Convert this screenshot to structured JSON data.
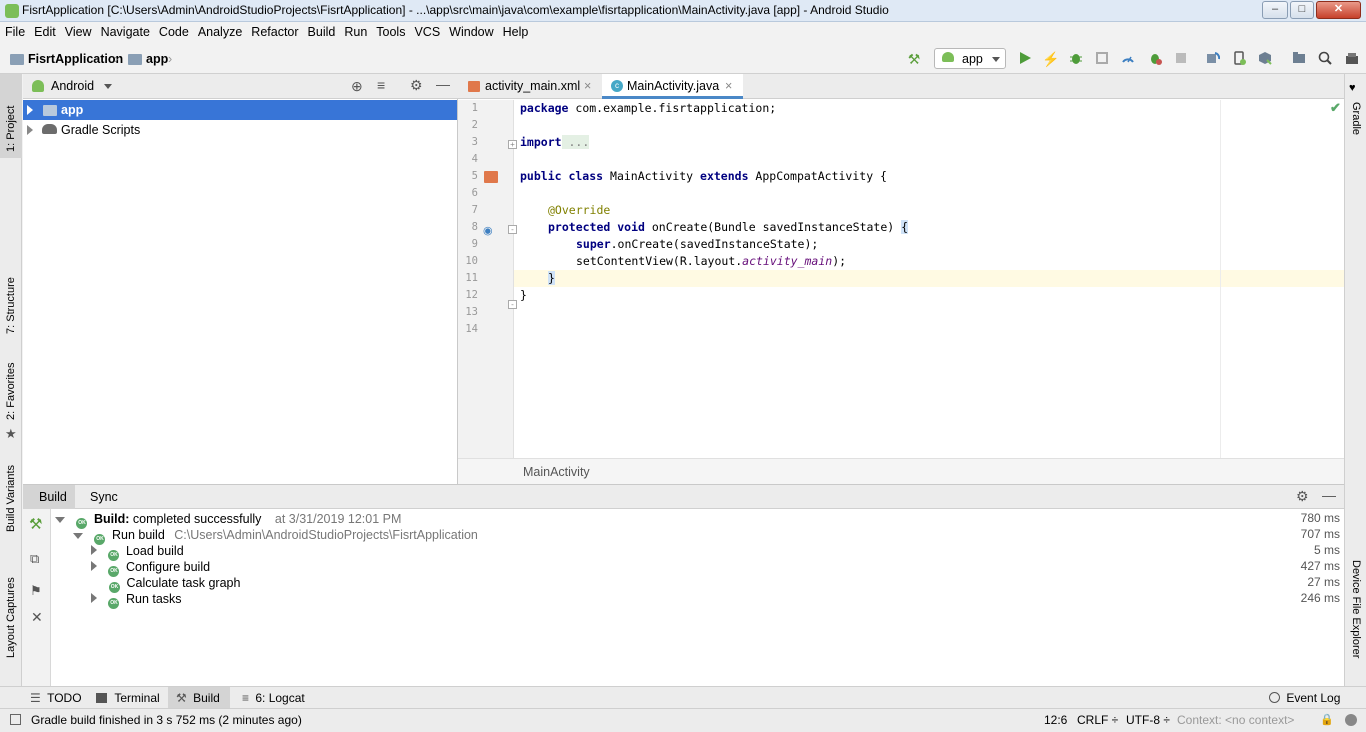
{
  "window": {
    "title": "FisrtApplication [C:\\Users\\Admin\\AndroidStudioProjects\\FisrtApplication] - ...\\app\\src\\main\\java\\com\\example\\fisrtapplication\\MainActivity.java [app] - Android Studio",
    "minimize": "–",
    "maximize": "□",
    "close": "✕"
  },
  "menu": [
    "File",
    "Edit",
    "View",
    "Navigate",
    "Code",
    "Analyze",
    "Refactor",
    "Build",
    "Run",
    "Tools",
    "VCS",
    "Window",
    "Help"
  ],
  "nav": {
    "project": "FisrtApplication",
    "module": "app",
    "run_config": "app",
    "sep": "›"
  },
  "left_tabs": [
    "1: Project",
    "7: Structure",
    "2: Favorites",
    "Build Variants",
    "Layout Captures"
  ],
  "right_tabs": [
    "Gradle",
    "Device File Explorer"
  ],
  "project_panel": {
    "view": "Android",
    "items": [
      {
        "label": "app"
      },
      {
        "label": "Gradle Scripts"
      }
    ]
  },
  "editor": {
    "tabs": [
      {
        "label": "activity_main.xml"
      },
      {
        "label": "MainActivity.java"
      }
    ],
    "tab_close": "×",
    "line_numbers": [
      "1",
      "2",
      "3",
      "4",
      "5",
      "6",
      "7",
      "8",
      "9",
      "10",
      "11",
      "12",
      "13",
      "14"
    ],
    "code": {
      "l1_kw": "package",
      "l1_rest": " com.example.fisrtapplication;",
      "l3_kw": "import",
      "l3_fold": " ...",
      "l6_kw1": "public class",
      "l6_mid": " MainActivity ",
      "l6_kw2": "extends",
      "l6_rest": " AppCompatActivity {",
      "l8_ann": "@Override",
      "l9_kw": "protected void",
      "l9_rest": " onCreate(Bundle savedInstanceState) ",
      "l9_brace": "{",
      "l10_kw": "super",
      "l10_rest": ".onCreate(savedInstanceState);",
      "l11_pre": "setContentView(R.layout.",
      "l11_fld": "activity_main",
      "l11_post": ");",
      "l12": "}",
      "l13": "}"
    },
    "breadcrumb": "MainActivity"
  },
  "build_panel": {
    "tabs": [
      "Build",
      "Sync"
    ],
    "ok": "OK",
    "rows": [
      {
        "bold": "Build:",
        "label": " completed successfully",
        "meta": "at 3/31/2019 12:01 PM",
        "time": "780 ms"
      },
      {
        "label": "Run build",
        "meta": "C:\\Users\\Admin\\AndroidStudioProjects\\FisrtApplication",
        "time": "707 ms"
      },
      {
        "label": "Load build",
        "time": "5 ms"
      },
      {
        "label": "Configure build",
        "time": "427 ms"
      },
      {
        "label": "Calculate task graph",
        "time": "27 ms"
      },
      {
        "label": "Run tasks",
        "time": "246 ms"
      }
    ]
  },
  "bottom_tabs": [
    "TODO",
    "Terminal",
    "Build",
    "6: Logcat"
  ],
  "event_log": "Event Log",
  "status": {
    "message": "Gradle build finished in 3 s 752 ms (2 minutes ago)",
    "position": "12:6",
    "line_sep": "CRLF ÷",
    "encoding": "UTF-8 ÷",
    "context": "Context: <no context>"
  },
  "colors": {
    "selection": "#3875d7",
    "accent": "#4a88c7",
    "ok_green": "#59a869",
    "keyword": "#000080"
  }
}
